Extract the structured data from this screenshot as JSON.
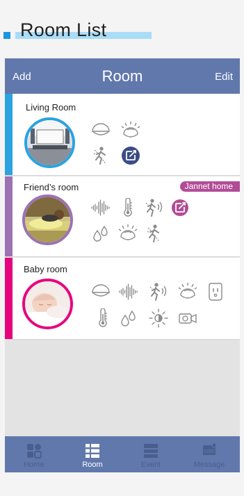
{
  "page_heading": "Room List",
  "header": {
    "add_label": "Add",
    "title": "Room",
    "edit_label": "Edit"
  },
  "colors": {
    "header": "#6178ad",
    "living": "#2aa3e0",
    "friend": "#9c72b3",
    "baby": "#e6047e",
    "tag": "#b24c97",
    "icon": "#8a8a8a"
  },
  "rooms": [
    {
      "name": "Living Room",
      "icons": [
        "dome-light-icon",
        "bulb-light-icon",
        "motion-sensor-icon",
        "edit-icon"
      ]
    },
    {
      "name": "Friend’s room",
      "tag": "Jannet home",
      "icons": [
        "sound-wave-icon",
        "thermometer-icon",
        "motion-sound-icon",
        "edit-icon",
        "humidity-icon",
        "bulb-light-icon",
        "motion-sensor-icon"
      ]
    },
    {
      "name": "Baby room",
      "icons": [
        "dome-light-icon",
        "sound-wave-icon",
        "motion-sound-icon",
        "bulb-light-icon",
        "smart-plug-icon",
        "thermometer-icon",
        "humidity-icon",
        "brightness-icon",
        "camera-icon"
      ]
    }
  ],
  "nav": [
    {
      "label": "Home",
      "icon": "home-grid-icon"
    },
    {
      "label": "Room",
      "icon": "room-list-icon",
      "active": true
    },
    {
      "label": "Event",
      "icon": "event-list-icon"
    },
    {
      "label": "Message",
      "icon": "message-icon"
    }
  ]
}
